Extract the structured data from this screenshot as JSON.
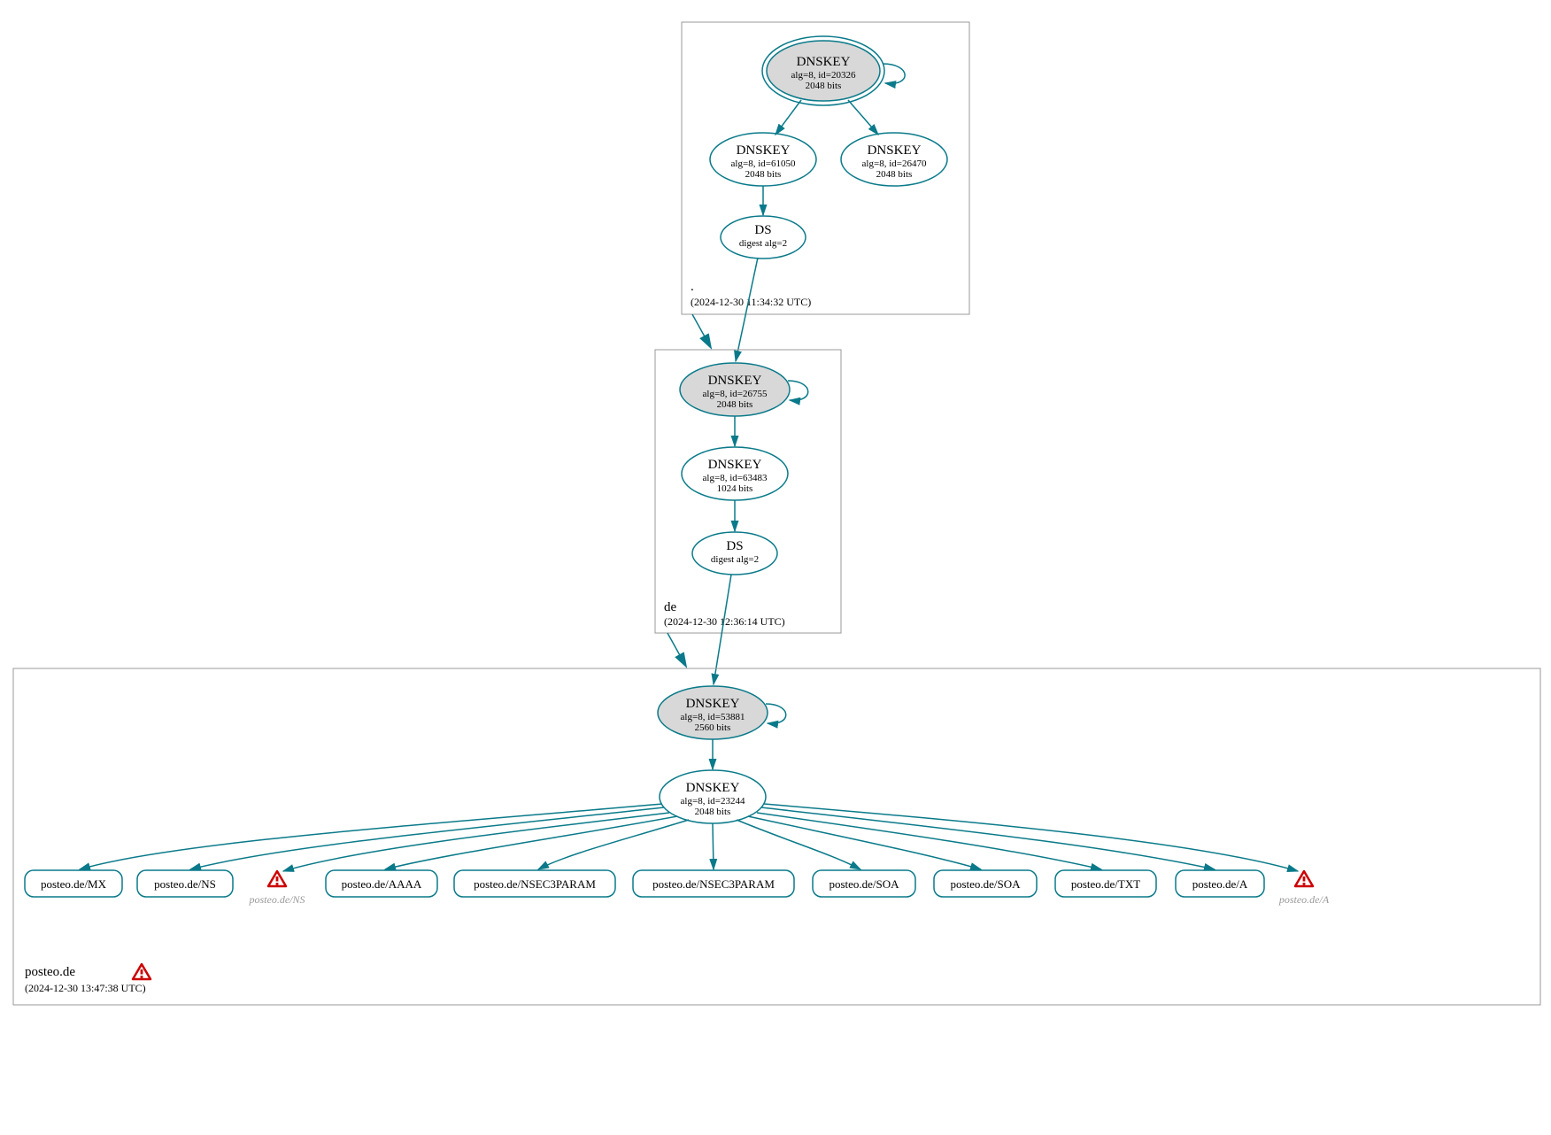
{
  "zones": {
    "root": {
      "name": ".",
      "time": "(2024-12-30 11:34:32 UTC)"
    },
    "de": {
      "name": "de",
      "time": "(2024-12-30 12:36:14 UTC)"
    },
    "posteo": {
      "name": "posteo.de",
      "time": "(2024-12-30 13:47:38 UTC)"
    }
  },
  "nodes": {
    "root_ksk": {
      "t": "DNSKEY",
      "s1": "alg=8, id=20326",
      "s2": "2048 bits"
    },
    "root_zsk1": {
      "t": "DNSKEY",
      "s1": "alg=8, id=61050",
      "s2": "2048 bits"
    },
    "root_zsk2": {
      "t": "DNSKEY",
      "s1": "alg=8, id=26470",
      "s2": "2048 bits"
    },
    "root_ds": {
      "t": "DS",
      "s1": "digest alg=2",
      "s2": ""
    },
    "de_ksk": {
      "t": "DNSKEY",
      "s1": "alg=8, id=26755",
      "s2": "2048 bits"
    },
    "de_zsk": {
      "t": "DNSKEY",
      "s1": "alg=8, id=63483",
      "s2": "1024 bits"
    },
    "de_ds": {
      "t": "DS",
      "s1": "digest alg=2",
      "s2": ""
    },
    "posteo_ksk": {
      "t": "DNSKEY",
      "s1": "alg=8, id=53881",
      "s2": "2560 bits"
    },
    "posteo_zsk": {
      "t": "DNSKEY",
      "s1": "alg=8, id=23244",
      "s2": "2048 bits"
    }
  },
  "rrsets": {
    "mx": "posteo.de/MX",
    "ns": "posteo.de/NS",
    "ns_warn": "posteo.de/NS",
    "aaaa": "posteo.de/AAAA",
    "n3p1": "posteo.de/NSEC3PARAM",
    "n3p2": "posteo.de/NSEC3PARAM",
    "soa1": "posteo.de/SOA",
    "soa2": "posteo.de/SOA",
    "txt": "posteo.de/TXT",
    "a": "posteo.de/A",
    "a_warn": "posteo.de/A"
  }
}
